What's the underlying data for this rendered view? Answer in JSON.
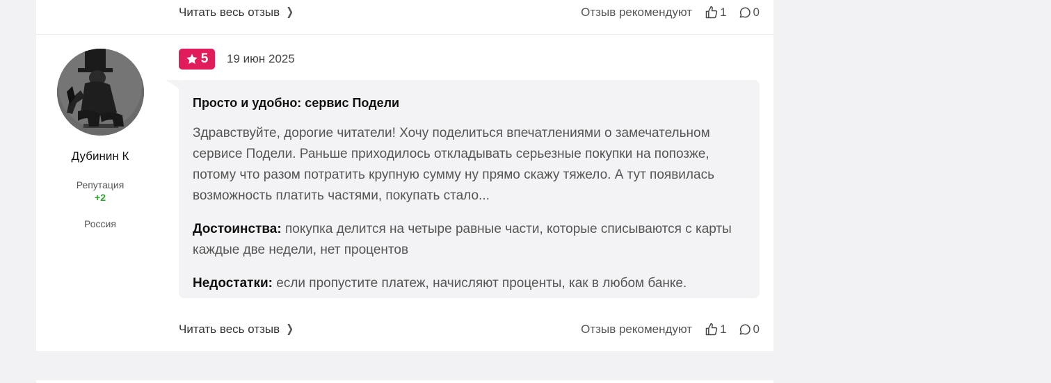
{
  "previous_review": {
    "read_more_label": "Читать весь отзыв",
    "recommend_label": "Отзыв рекомендуют",
    "likes": "1",
    "comments": "0"
  },
  "review": {
    "author": {
      "name": "Дубинин К",
      "reputation_label": "Репутация",
      "reputation_value": "+2",
      "country": "Россия"
    },
    "rating": "5",
    "date": "19 июн 2025",
    "title": "Просто и удобно: сервис Подели",
    "body": "Здравствуйте, дорогие читатели! Хочу поделиться впечатлениями о замечательном сервисе Подели. Раньше приходилось откладывать серьезные покупки на попозже, потому что разом потратить крупную сумму ну прямо скажу тяжело. А тут появилась возможность платить частями, покупать стало...",
    "pros_label": "Достоинства:",
    "pros": "покупка делится на четыре равные части, которые списываются с карты каждые две недели, нет процентов",
    "cons_label": "Недостатки:",
    "cons": "если пропустите платеж, начисляют проценты, как в любом банке.",
    "read_more_label": "Читать весь отзыв",
    "recommend_label": "Отзыв рекомендуют",
    "likes": "1",
    "comments": "0"
  },
  "colors": {
    "rating_badge": "#e01c5a",
    "reputation_positive": "#2aa52a",
    "page_background": "#f2f2f4"
  }
}
